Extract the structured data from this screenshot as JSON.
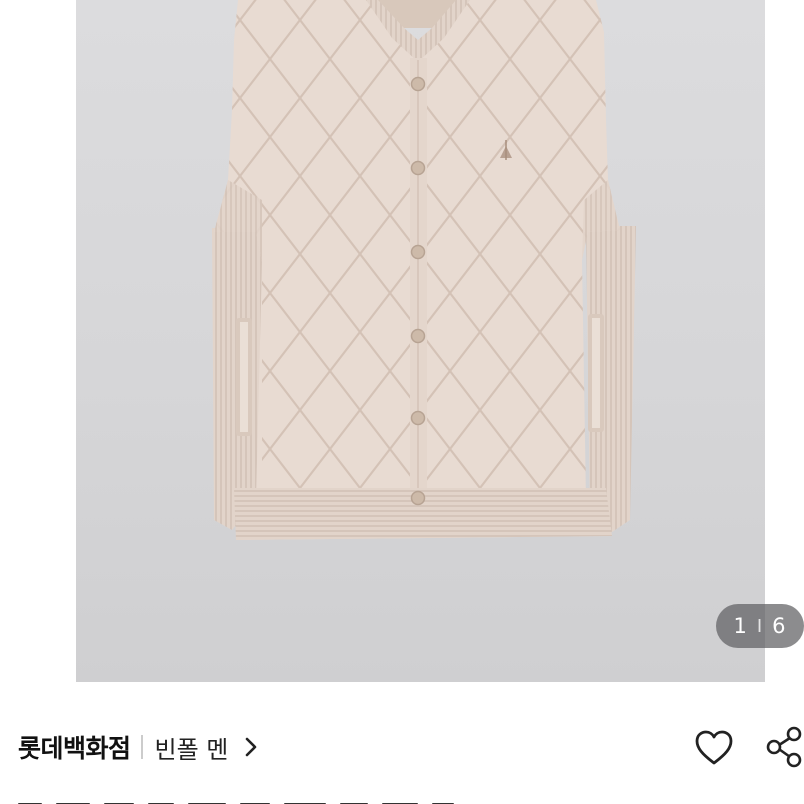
{
  "gallery": {
    "current": "1",
    "separator": "I",
    "total": "6",
    "image_icon": "quilted-vest-photo"
  },
  "product": {
    "store_name": "롯데백화점",
    "brand_name": "빈폴 멘"
  },
  "icons": {
    "brand_link": "chevron-right-icon",
    "like": "heart-icon",
    "share": "share-icon"
  },
  "colors": {
    "vest": "#e7d9d0",
    "background": "#d6d6d8",
    "counter_bg": "#5f5f62"
  }
}
